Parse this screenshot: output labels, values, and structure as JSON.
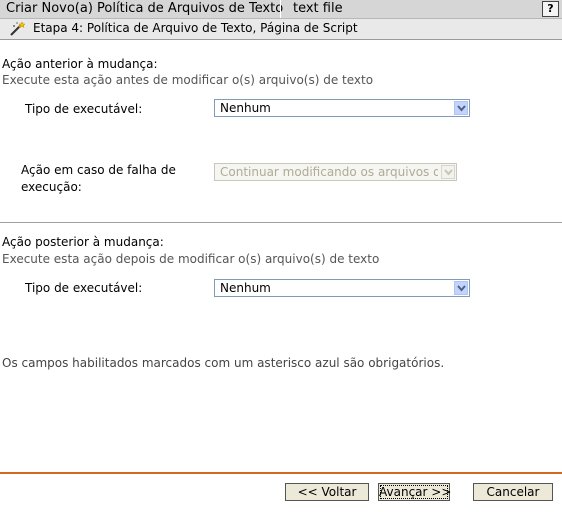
{
  "header": {
    "title": "Criar Novo(a) Política de Arquivos de Texto",
    "object_name": "text file",
    "help_label": "?"
  },
  "step": {
    "title": "Etapa 4: Política de Arquivo de Texto, Página de Script",
    "icon": "wand-icon"
  },
  "pre_change": {
    "title": "Ação anterior à mudança:",
    "description": "Execute esta ação antes de modificar o(s) arquivo(s) de texto",
    "executable_label": "Tipo de executável:",
    "executable_value": "Nenhum",
    "failure_label_line1": "Ação em caso de falha de",
    "failure_label_line2": "execução:",
    "failure_value": "Continuar modificando os arquivos de texto"
  },
  "post_change": {
    "title": "Ação posterior à mudança:",
    "description": "Execute esta ação depois de modificar o(s) arquivo(s) de texto",
    "executable_label": "Tipo de executável:",
    "executable_value": "Nenhum"
  },
  "required_note": "Os campos habilitados marcados com um asterisco azul são obrigatórios.",
  "buttons": {
    "back": "<< Voltar",
    "next": "Avançar >>",
    "cancel": "Cancelar"
  },
  "colors": {
    "footer_rule": "#d4681c",
    "dropdown_arrow_bg": "#c3d3fd"
  }
}
